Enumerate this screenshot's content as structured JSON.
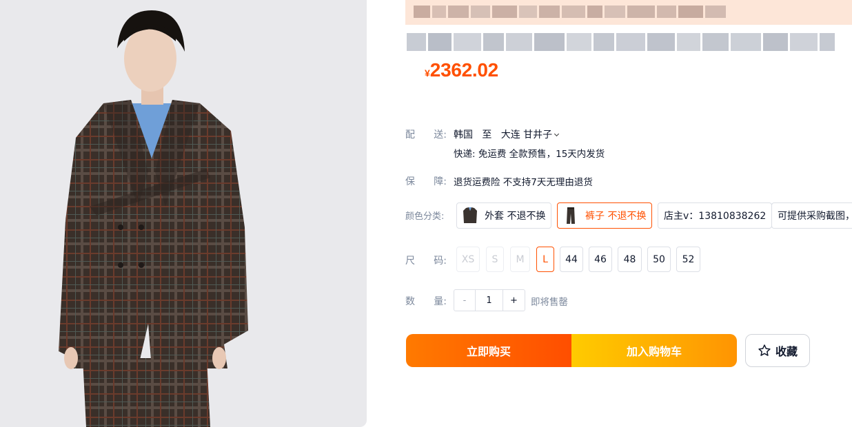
{
  "price": {
    "currency": "¥",
    "amount": "2362.02"
  },
  "shipping": {
    "label_chars": [
      "配",
      "送"
    ],
    "colon": ":",
    "origin": "韩国",
    "to": "至",
    "destination": "大连 甘井子",
    "detail": "快递: 免运费  全款预售，15天内发货"
  },
  "guarantee": {
    "label_chars": [
      "保",
      "障"
    ],
    "colon": ":",
    "text": "退货运费险 不支持7天无理由退货"
  },
  "color": {
    "label": "颜色分类:",
    "options": [
      {
        "label": "外套 不退不换",
        "selected": false,
        "thumb": "jacket-thumbnail"
      },
      {
        "label": "裤子 不退不换",
        "selected": true,
        "thumb": "pants-thumbnail"
      },
      {
        "label": "店主v：13810838262",
        "selected": false
      },
      {
        "label": "可提供采购截图，",
        "selected": false
      }
    ]
  },
  "size": {
    "label_chars": [
      "尺",
      "码"
    ],
    "colon": ":",
    "options": [
      {
        "label": "XS",
        "state": "disabled"
      },
      {
        "label": "S",
        "state": "disabled"
      },
      {
        "label": "M",
        "state": "disabled"
      },
      {
        "label": "L",
        "state": "selected"
      },
      {
        "label": "44",
        "state": "normal"
      },
      {
        "label": "46",
        "state": "normal"
      },
      {
        "label": "48",
        "state": "normal"
      },
      {
        "label": "50",
        "state": "normal"
      },
      {
        "label": "52",
        "state": "normal"
      }
    ]
  },
  "quantity": {
    "label_chars": [
      "数",
      "量"
    ],
    "colon": ":",
    "minus": "-",
    "value": "1",
    "plus": "+",
    "note": "即将售罄"
  },
  "actions": {
    "buy_now": "立即购买",
    "add_to_cart": "加入购物车",
    "favorite": "收藏"
  },
  "colors": {
    "accent": "#ff5000",
    "banner_bg": "#fde6d8",
    "label_grey": "#7c889c"
  }
}
